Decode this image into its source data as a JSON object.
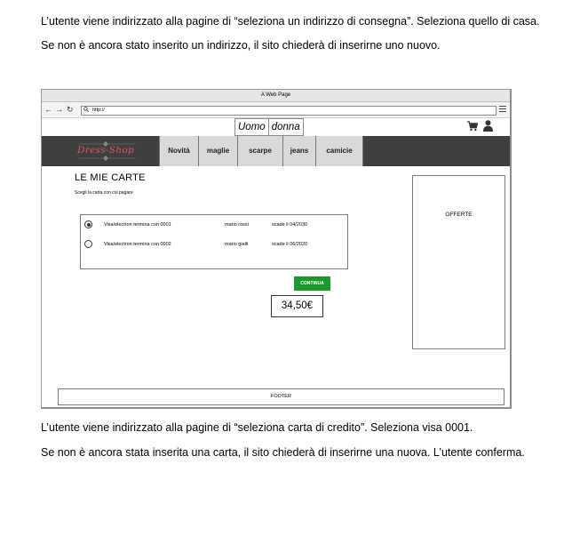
{
  "doc": {
    "para1": "L’utente viene indirizzato alla pagine di “seleziona un indirizzo di consegna”. Seleziona quello di casa.",
    "para2": "Se non è ancora stato inserito un indirizzo, il sito chiederà di inserirne uno nuovo.",
    "para3": "L’utente viene indirizzato alla pagine di “seleziona carta di credito”. Seleziona visa 0001.",
    "para4": "Se non è ancora stata inserita una carta, il sito chiederà di inserirne una nuova. L’utente conferma."
  },
  "mockup": {
    "window_title": "A Web Page",
    "url": "http://",
    "gender": [
      "Uomo",
      "donna"
    ],
    "logo": "Dress-Shop",
    "nav": [
      "Novità",
      "maglie",
      "scarpe",
      "jeans",
      "camicie"
    ],
    "page_title": "LE MIE CARTE",
    "subtitle": "Scegli la carta con cui pagare",
    "cards": [
      {
        "card": "Visa/electron  termina con 0001",
        "owner": "mario rossi",
        "expiry": "scade il 04/2030",
        "selected": true
      },
      {
        "card": "Visa/electron  termina con 0002",
        "owner": "mario gialli",
        "expiry": "scade il 06/2020",
        "selected": false
      }
    ],
    "continue_label": "CONTINUA",
    "price": "34,50€",
    "offers": "OFFERTE",
    "footer": "FOOTER",
    "colors": {
      "continue": "#1a9a2c",
      "navbar": "#3f3f3f",
      "logo": "#d9556b"
    },
    "icons": [
      "back-arrow-icon",
      "forward-arrow-icon",
      "reload-icon",
      "search-icon",
      "menu-icon",
      "cart-icon",
      "user-icon"
    ]
  }
}
